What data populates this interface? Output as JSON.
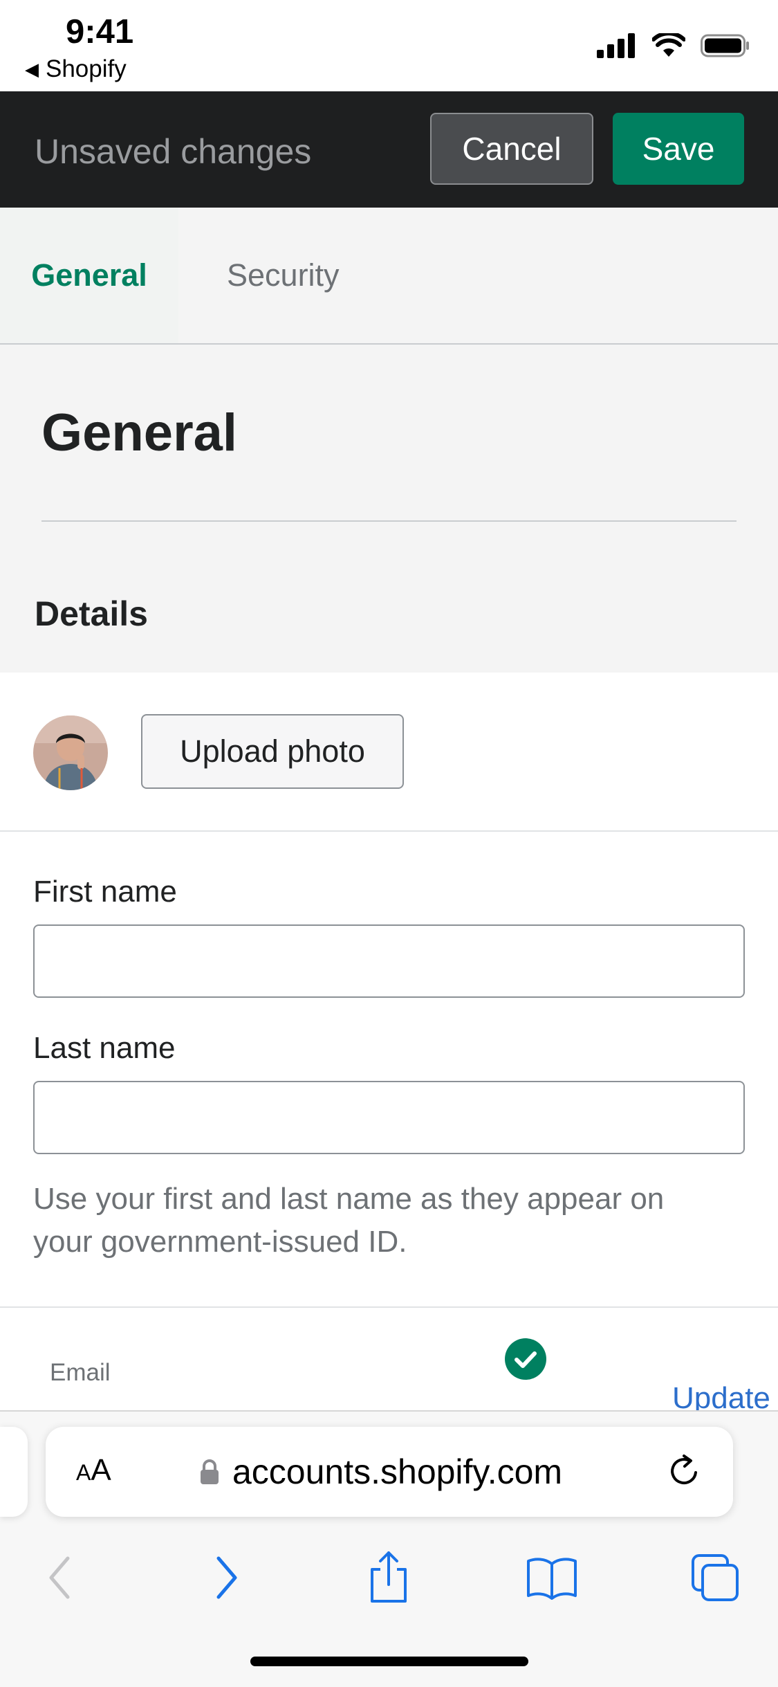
{
  "status_bar": {
    "time": "9:41",
    "back_app": "Shopify"
  },
  "top_bar": {
    "title": "Unsaved changes",
    "cancel_label": "Cancel",
    "save_label": "Save"
  },
  "tabs": [
    {
      "label": "General",
      "active": true
    },
    {
      "label": "Security",
      "active": false
    }
  ],
  "page": {
    "title": "General",
    "section_title": "Details"
  },
  "profile": {
    "upload_label": "Upload photo"
  },
  "form": {
    "first_name": {
      "label": "First name",
      "value": ""
    },
    "last_name": {
      "label": "Last name",
      "value": ""
    },
    "help_text": "Use your first and last name as they appear on your government-issued ID.",
    "email_label": "Email",
    "update_label": "Update"
  },
  "browser": {
    "aa_small": "A",
    "aa_large": "A",
    "url": "accounts.shopify.com"
  },
  "colors": {
    "accent": "#008060",
    "top_bar": "#1e1f20",
    "link": "#2c6ecb",
    "ios_blue": "#1a73e8"
  }
}
